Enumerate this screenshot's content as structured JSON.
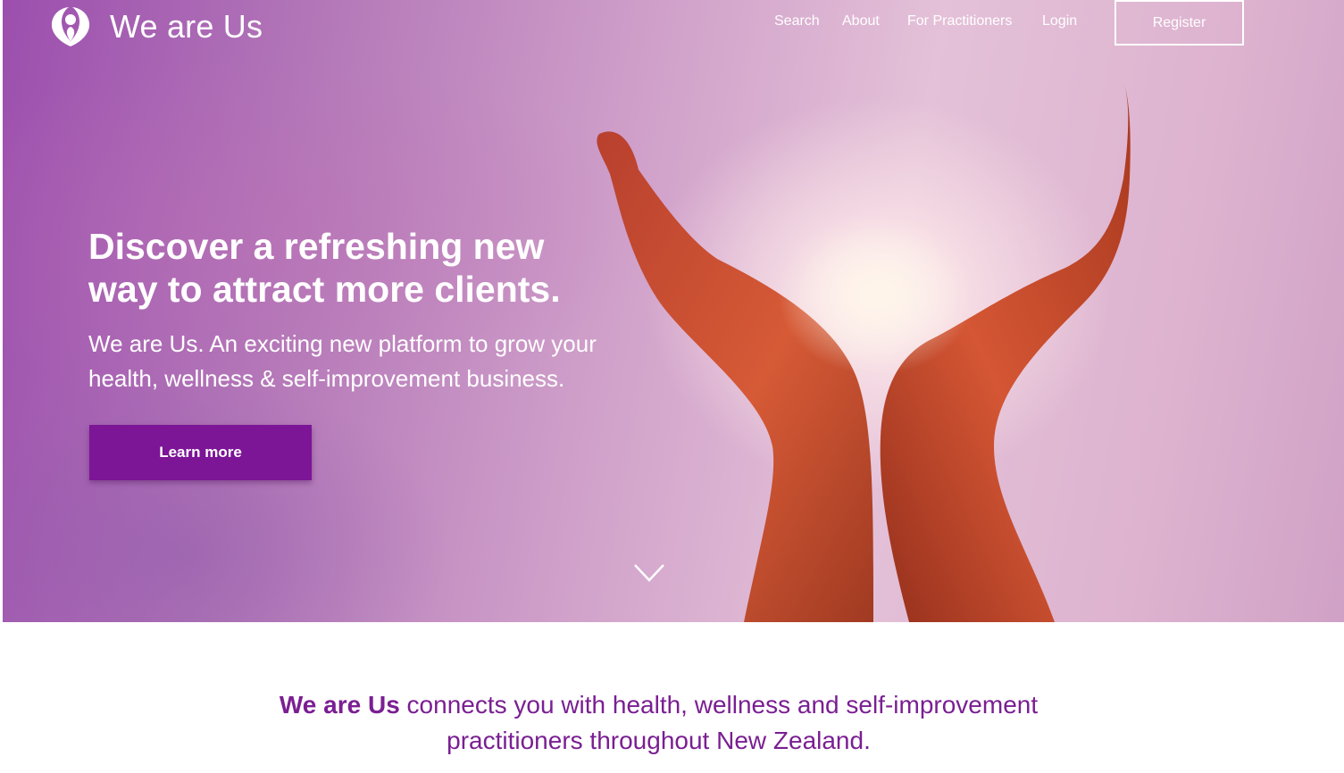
{
  "brand": {
    "name": "We are Us",
    "logo_icon": "person-heart-logo-icon"
  },
  "nav": {
    "items": [
      {
        "label": "Search"
      },
      {
        "label": "About"
      },
      {
        "label": "For Practitioners"
      },
      {
        "label": "Login"
      }
    ],
    "register_label": "Register"
  },
  "hero": {
    "headline_line1": "Discover a refreshing new",
    "headline_line2": "way to attract more clients.",
    "subhead_line1": "We are Us. An exciting new platform to grow your",
    "subhead_line2": "health, wellness & self-improvement business.",
    "cta_label": "Learn more",
    "scroll_icon": "chevron-down-icon"
  },
  "intro": {
    "brand_text": "We are Us",
    "text_line1": "connects you with health, wellness and self-improvement",
    "text_line2": "practitioners throughout New Zealand."
  },
  "colors": {
    "accent": "#7c1596",
    "intro_text": "#7a1f92",
    "hands": "#c84a30"
  }
}
